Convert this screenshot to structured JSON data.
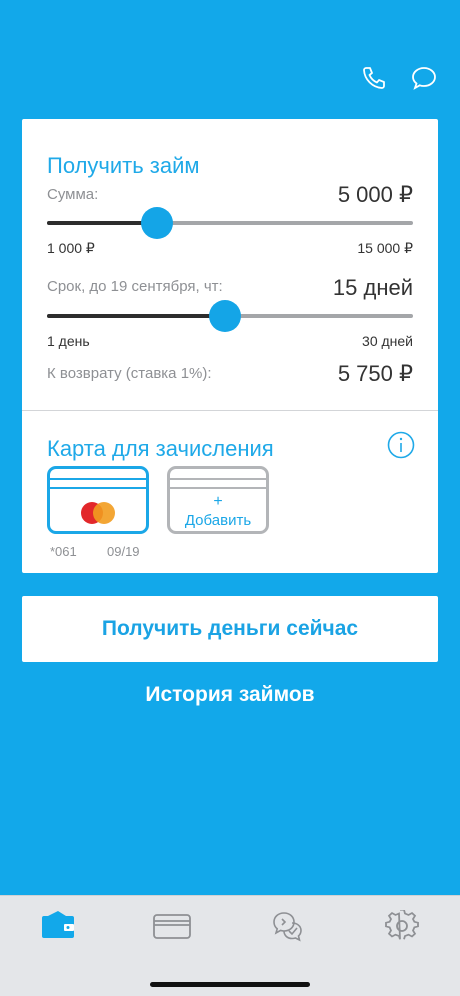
{
  "header": {
    "icons": [
      "phone-icon",
      "chat-bubble-icon"
    ]
  },
  "loan": {
    "title": "Получить займ",
    "amount_label": "Сумма:",
    "amount_value": "5 000 ₽",
    "amount_min": "1 000 ₽",
    "amount_max": "15 000 ₽",
    "amount_slider_fraction": 0.3,
    "term_label": "Срок, до 19 сентября, чт:",
    "term_value": "15 дней",
    "term_min": "1 день",
    "term_max": "30 дней",
    "term_slider_fraction": 0.485,
    "return_label": "К возврату (ставка 1%):",
    "return_value": "5 750 ₽"
  },
  "cards": {
    "title": "Карта для зачисления",
    "info_icon": "info-icon",
    "selected": {
      "brand_icon": "mastercard-icon",
      "number": "*061",
      "expiry": "09/19"
    },
    "add_plus": "+",
    "add_label": "Добавить"
  },
  "actions": {
    "get_money": "Получить деньги сейчас",
    "history": "История займов"
  },
  "tabbar": {
    "items": [
      "wallet-icon",
      "card-icon",
      "chat-check-icon",
      "settings-icon"
    ],
    "active": "wallet-icon"
  },
  "colors": {
    "background": "#12a8ea",
    "accent": "#1fa9e8",
    "text_dark": "#333333",
    "text_muted": "#8e9094"
  }
}
